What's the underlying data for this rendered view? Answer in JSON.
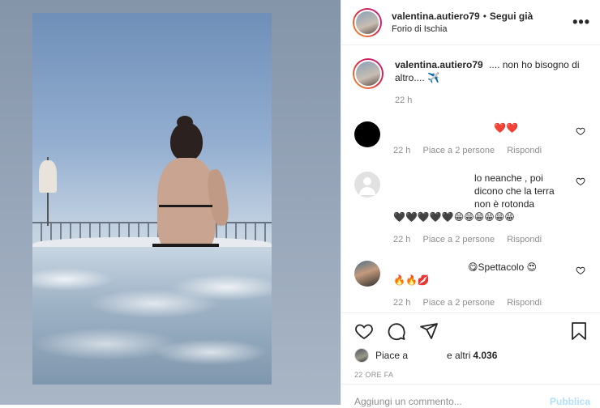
{
  "header": {
    "username": "valentina.autiero79",
    "separator": "•",
    "follow_label": "Segui già",
    "location": "Forio di Ischia",
    "more_icon": "more-horizontal-icon",
    "more_glyph": "•••"
  },
  "caption": {
    "username": "valentina.autiero79",
    "text": ".... non ho bisogno di altro.... ✈️",
    "time": "22 h"
  },
  "comments": [
    {
      "avatar": "black-avatar",
      "emoji": "❤️❤️",
      "time": "22 h",
      "likes": "Piace a 2 persone",
      "reply": "Rispondi"
    },
    {
      "avatar": "default-avatar",
      "text": "lo neanche , poi dicono che la terra non è rotonda",
      "emoji": "🖤🖤🖤🖤🖤😁😁😁😁😁😁",
      "time": "22 h",
      "likes": "Piace a 2 persone",
      "reply": "Rispondi"
    },
    {
      "avatar": "photo-avatar",
      "text": "😋Spettacolo 😍",
      "emoji": "🔥🔥💋",
      "time": "22 h",
      "likes": "Piace a 2 persone",
      "reply": "Rispondi"
    }
  ],
  "actions": {
    "likes_prefix": "Piace a",
    "likes_suffix": "e altri",
    "likes_count": "4.036",
    "timestamp": "22 ORE FA"
  },
  "add_comment": {
    "placeholder": "Aggiungi un commento...",
    "publish_label": "Pubblica"
  },
  "colors": {
    "text": "#262626",
    "muted": "#8e8e8e",
    "publish_disabled": "#b2dffc",
    "heart_red": "#e0245e"
  }
}
